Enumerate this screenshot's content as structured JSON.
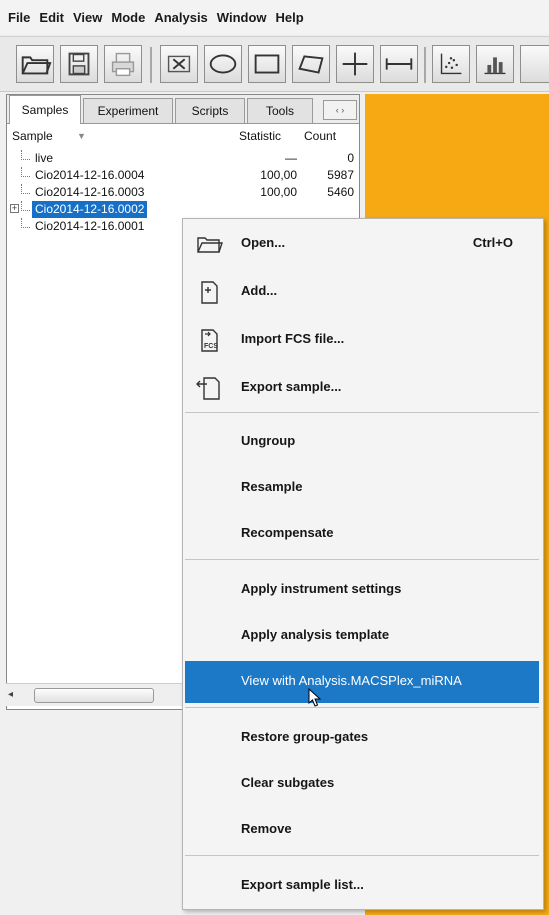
{
  "menubar": [
    "File",
    "Edit",
    "View",
    "Mode",
    "Analysis",
    "Window",
    "Help"
  ],
  "toolbar": {
    "icons": [
      "open-folder-icon",
      "save-icon",
      "print-icon",
      "delete-x-icon",
      "ellipse-gate-icon",
      "rectangle-gate-icon",
      "polygon-gate-icon",
      "quadrant-gate-icon",
      "range-gate-icon",
      "dot-plot-icon",
      "more-icon"
    ]
  },
  "tabs": [
    "Samples",
    "Experiment",
    "Scripts",
    "Tools"
  ],
  "tab_scroll": "‹ ›",
  "tree": {
    "headers": {
      "sample": "Sample",
      "sort": "▼",
      "statistic": "Statistic",
      "count": "Count"
    },
    "rows": [
      {
        "name": "live",
        "statistic": "—",
        "count": "0"
      },
      {
        "name": "Cio2014-12-16.0004",
        "statistic": "100,00",
        "count": "5987"
      },
      {
        "name": "Cio2014-12-16.0003",
        "statistic": "100,00",
        "count": "5460"
      },
      {
        "name": "Cio2014-12-16.0002",
        "statistic": "",
        "count": "",
        "expander": "+"
      },
      {
        "name": "Cio2014-12-16.0001",
        "statistic": "",
        "count": ""
      }
    ]
  },
  "scrollbar": {
    "left_arrow": "◂"
  },
  "context_menu": {
    "items": [
      {
        "label": "Open...",
        "shortcut": "Ctrl+O",
        "icon": "open-folder-icon"
      },
      {
        "label": "Add...",
        "icon": "add-file-icon"
      },
      {
        "label": "Import FCS file...",
        "icon": "import-fcs-icon",
        "icon_text": "FCS"
      },
      {
        "label": "Export sample...",
        "icon": "export-file-icon"
      },
      {
        "label": "Ungroup"
      },
      {
        "label": "Resample"
      },
      {
        "label": "Recompensate"
      },
      {
        "label": "Apply instrument settings"
      },
      {
        "label": "Apply analysis template"
      },
      {
        "label": "View with Analysis.MACSPlex_miRNA",
        "highlighted": true
      },
      {
        "label": "Restore group-gates"
      },
      {
        "label": "Clear subgates"
      },
      {
        "label": "Remove"
      },
      {
        "label": "Export sample list..."
      }
    ]
  },
  "colors": {
    "accent": "#1b79c8",
    "background_panel": "#f6a913",
    "selection": "#1670c8"
  }
}
